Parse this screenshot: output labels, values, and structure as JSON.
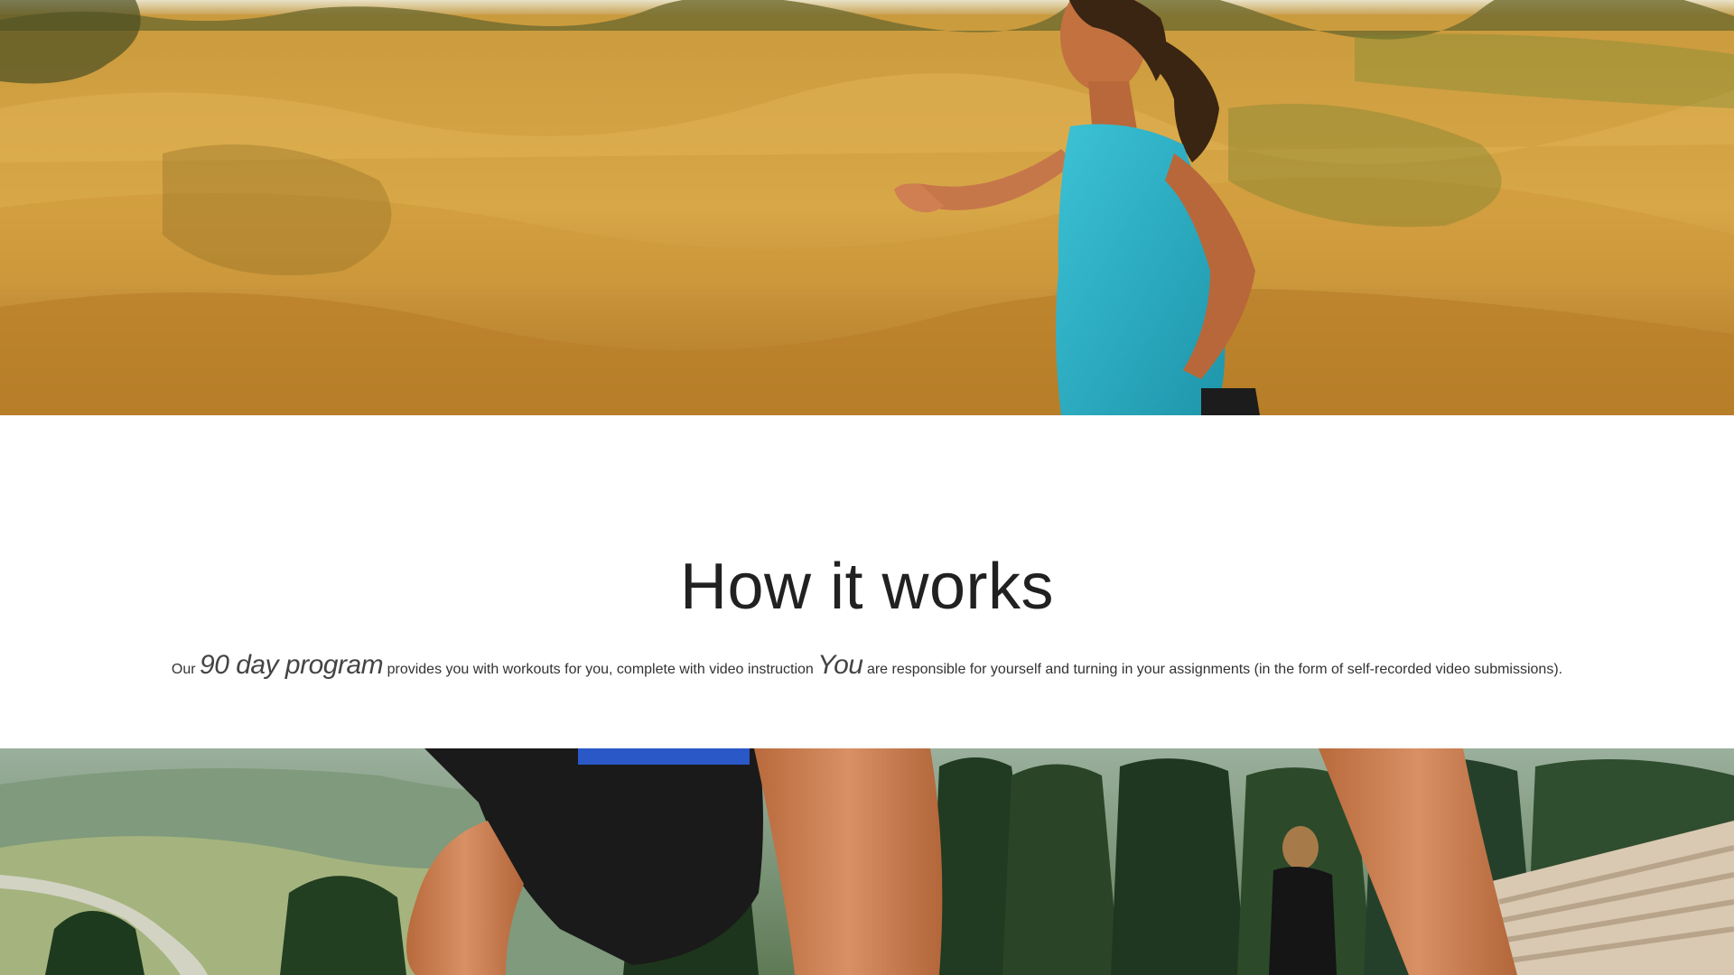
{
  "hero_top": {
    "icon": "runner-in-field-photo"
  },
  "how_it_works": {
    "title": "How it works",
    "desc_intro": "Our",
    "desc_program": "90 day program",
    "desc_middle": "provides you with workouts for you, complete with video instruction",
    "desc_you": "You",
    "desc_end": "are responsible for yourself and turning in your assignments (in the form of self-recorded video submissions)."
  },
  "hero_bottom": {
    "icon": "runner-climbing-stairs-photo"
  },
  "colors": {
    "title": "#212121",
    "body_text": "#333333",
    "background": "#ffffff",
    "tank_top": "#2aaec4",
    "grass": "#d4a244"
  }
}
